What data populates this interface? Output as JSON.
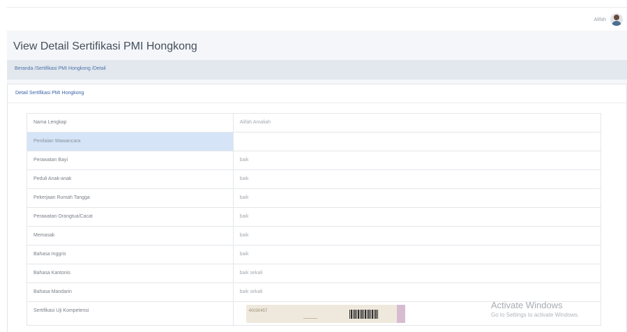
{
  "topbar": {
    "user_name": "Alifah"
  },
  "page": {
    "title": "View Detail Sertifikasi PMI Hongkong"
  },
  "breadcrumb": "Beranda /Sertifikasi PMI Hongkong /Detail",
  "card": {
    "header": "Detail Sertifikasi PMI Hongkong"
  },
  "table": {
    "rows": [
      {
        "label": "Nama Lengkap",
        "value": "Alifah Amaliah"
      },
      {
        "label": "Penilaian Wawancara",
        "value": ""
      },
      {
        "label": "Perawatan Bayi",
        "value": "baik"
      },
      {
        "label": "Peduli Anak-anak",
        "value": "baik"
      },
      {
        "label": "Pekerjaan Rumah Tangga",
        "value": "baik"
      },
      {
        "label": "Perawatan Orangtua/Cacat",
        "value": "baik"
      },
      {
        "label": "Memasak",
        "value": "baik"
      },
      {
        "label": "Bahasa Inggris",
        "value": "baik"
      },
      {
        "label": "Bahasa Kantonis",
        "value": "baik sekali"
      },
      {
        "label": "Bahasa Mandarin",
        "value": "baik sekali"
      },
      {
        "label": "Sertifikasi Uji Kompetensi",
        "value": ""
      }
    ],
    "certificate_stamp": "40030457"
  },
  "watermark": {
    "line1": "Activate Windows",
    "line2": "Go to Settings to activate Windows."
  },
  "colors": {
    "breadcrumb_bg": "#e3e8ee",
    "section_bg": "#d5e5f7",
    "link": "#3a63a8"
  }
}
